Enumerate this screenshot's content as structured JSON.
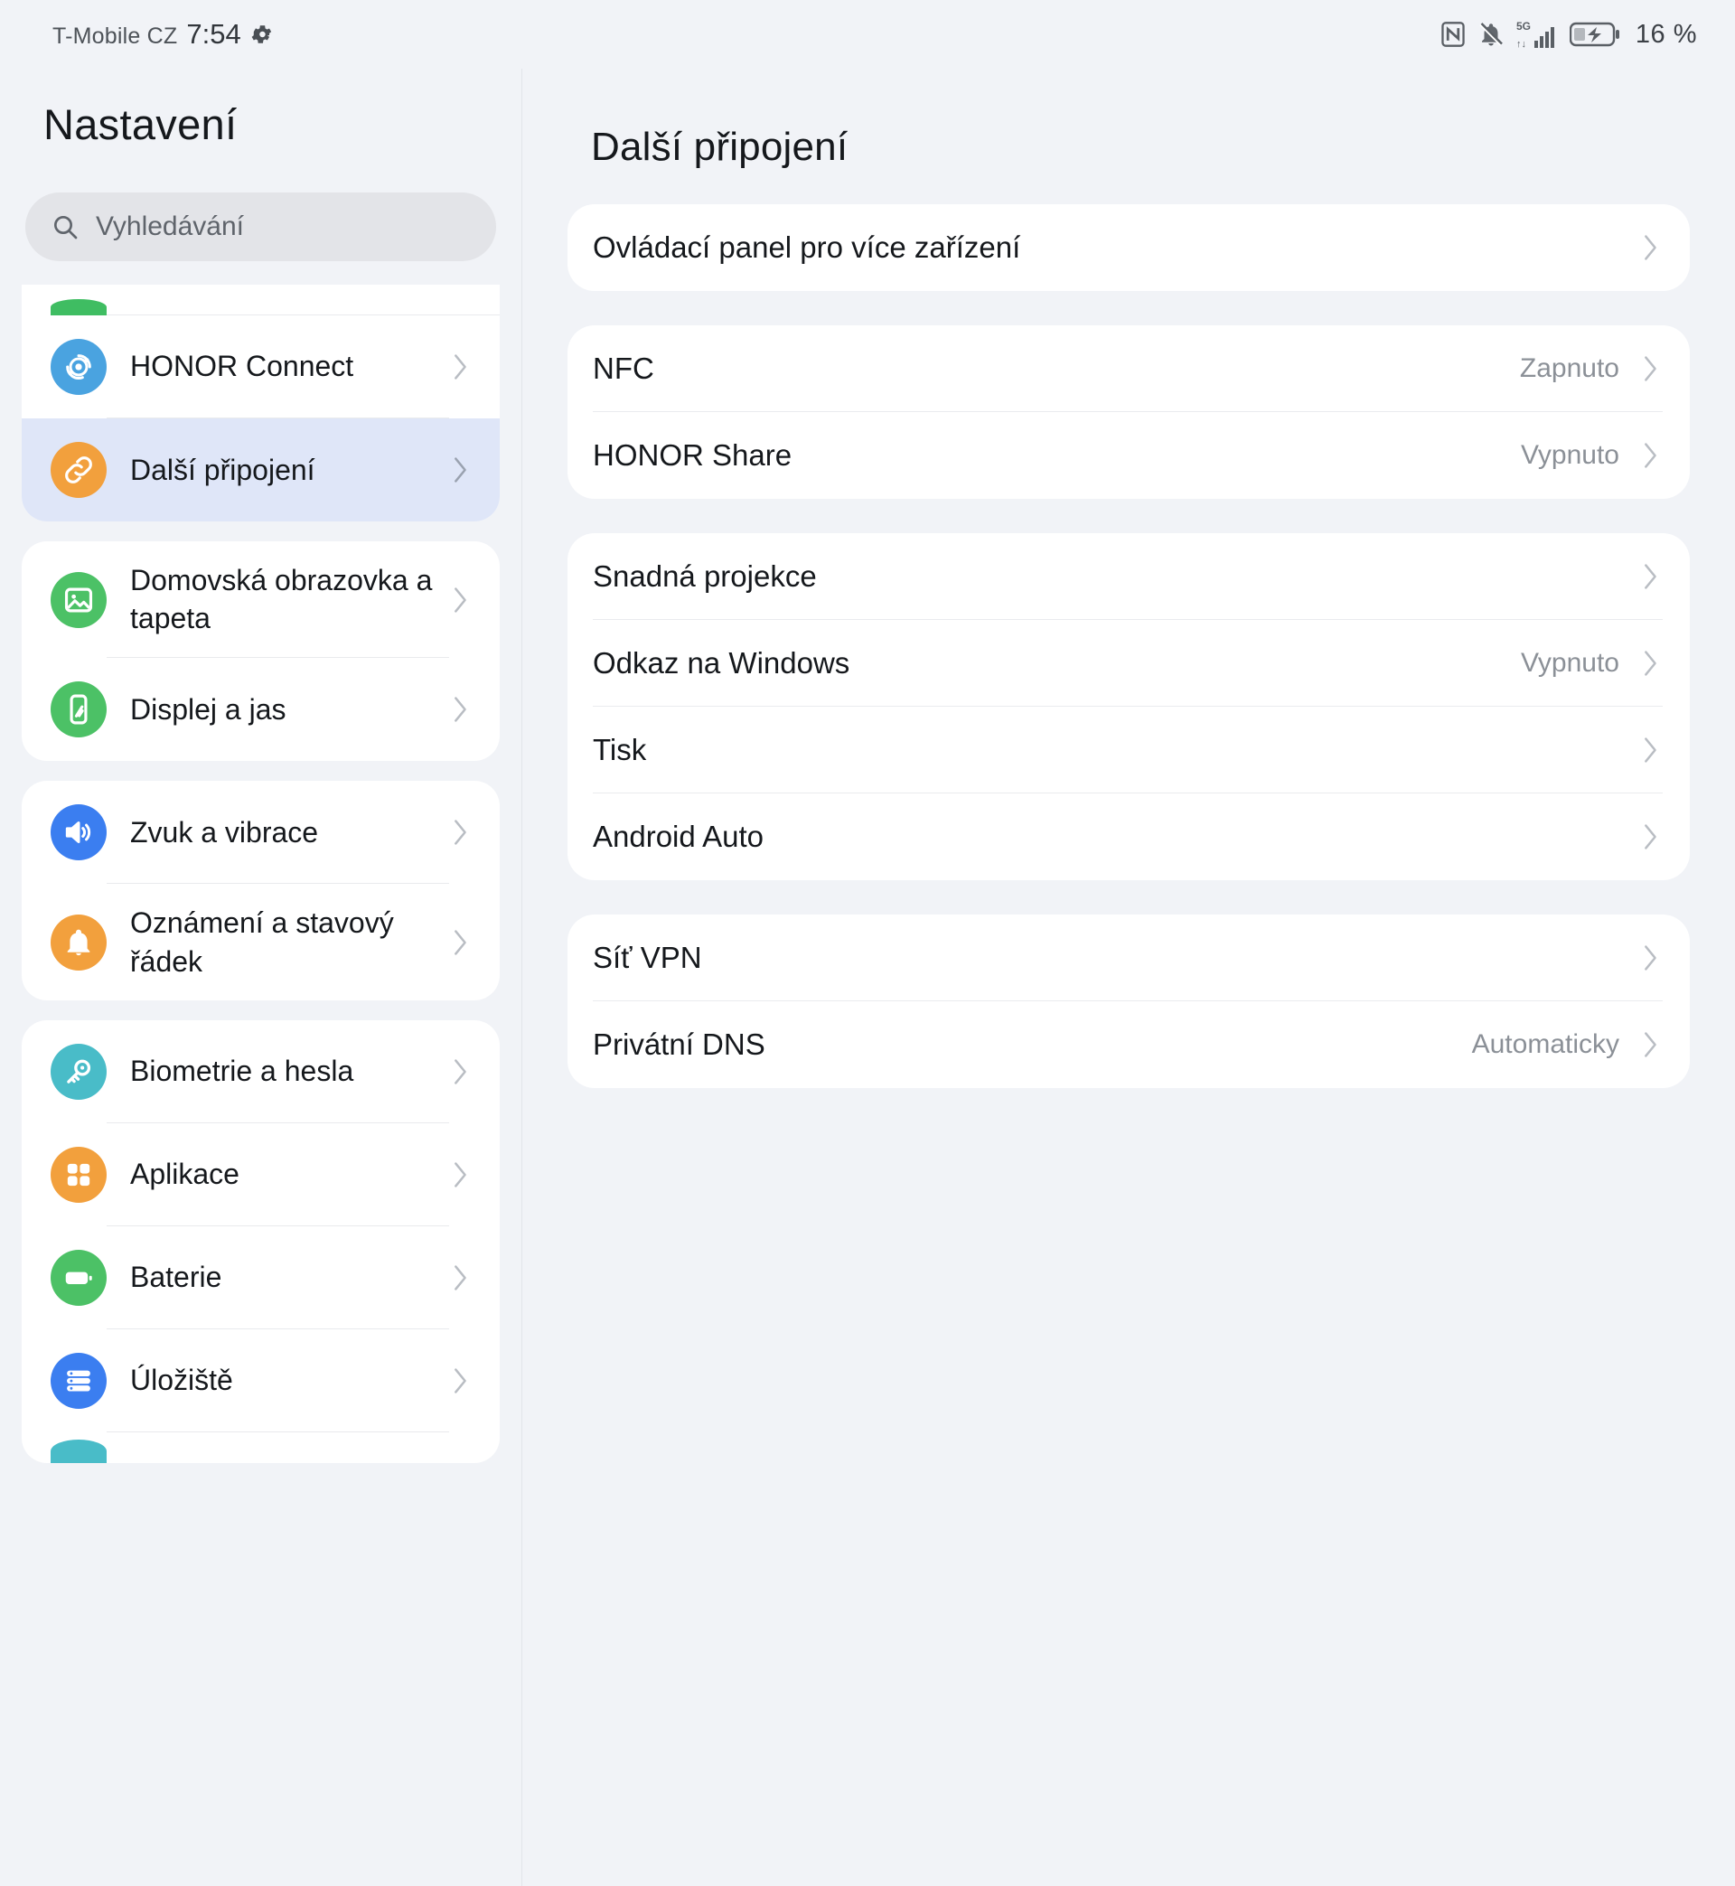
{
  "status_bar": {
    "carrier": "T-Mobile CZ",
    "time": "7:54",
    "gear_icon": "gear-icon",
    "icons": [
      "nfc-icon",
      "bell-muted-icon",
      "signal-5g-icon",
      "battery-charging-icon"
    ],
    "battery_text": "16 %"
  },
  "sidebar": {
    "title": "Nastaveni_PLACEHOLDER",
    "title_text": "Nastavení",
    "search": {
      "placeholder": "Vyhledávání",
      "value": "",
      "icon": "search-icon"
    },
    "groups": [
      {
        "clipped": true,
        "items": [
          {
            "label": "",
            "icon": "partial-green-icon",
            "color": "#3fbd62",
            "partial": true,
            "chevron": false
          },
          {
            "label": "HONOR Connect",
            "icon": "honor-connect-icon",
            "color": "#4aa3e0",
            "chevron": true,
            "selected": false
          },
          {
            "label": "Další připojení",
            "icon": "link-icon",
            "color": "#f2a03d",
            "chevron": true,
            "selected": true
          }
        ]
      },
      {
        "items": [
          {
            "label": "Domovská obrazovka a tapeta",
            "icon": "wallpaper-icon",
            "color": "#4cc166",
            "chevron": true
          },
          {
            "label": "Displej a jas",
            "icon": "display-brightness-icon",
            "color": "#4cc166",
            "chevron": true
          }
        ]
      },
      {
        "items": [
          {
            "label": "Zvuk a vibrace",
            "icon": "speaker-icon",
            "color": "#3b7ef0",
            "chevron": true
          },
          {
            "label": "Oznámení a stavový řádek",
            "icon": "bell-icon",
            "color": "#f2a03d",
            "chevron": true
          }
        ]
      },
      {
        "items": [
          {
            "label": "Biometrie a hesla",
            "icon": "key-icon",
            "color": "#49bcc8",
            "chevron": true
          },
          {
            "label": "Aplikace",
            "icon": "apps-grid-icon",
            "color": "#f2a03d",
            "chevron": true
          },
          {
            "label": "Baterie",
            "icon": "battery-icon",
            "color": "#4cc166",
            "chevron": true
          },
          {
            "label": "Úložiště",
            "icon": "storage-icon",
            "color": "#3b7ef0",
            "chevron": true
          },
          {
            "label": "",
            "icon": "partial-teal-icon",
            "color": "#49bcc8",
            "partial": true,
            "chevron": false
          }
        ]
      }
    ]
  },
  "main": {
    "title": "Další připojení",
    "groups": [
      {
        "rows": [
          {
            "label": "Ovládací panel pro více zařízení",
            "value": "",
            "chevron": true
          }
        ]
      },
      {
        "rows": [
          {
            "label": "NFC",
            "value": "Zapnuto",
            "chevron": true
          },
          {
            "label": "HONOR Share",
            "value": "Vypnuto",
            "chevron": true
          }
        ]
      },
      {
        "rows": [
          {
            "label": "Snadná projekce",
            "value": "",
            "chevron": true
          },
          {
            "label": "Odkaz na Windows",
            "value": "Vypnuto",
            "chevron": true
          },
          {
            "label": "Tisk",
            "value": "",
            "chevron": true
          },
          {
            "label": "Android Auto",
            "value": "",
            "chevron": true
          }
        ]
      },
      {
        "rows": [
          {
            "label": "Síť VPN",
            "value": "",
            "chevron": true
          },
          {
            "label": "Privátní DNS",
            "value": "Automaticky",
            "chevron": true
          }
        ]
      }
    ]
  },
  "colors": {
    "page_bg": "#f1f3f7",
    "card_bg": "#ffffff",
    "selected_bg": "#dfe6f8",
    "text_primary": "#15181c",
    "text_secondary": "#8b9097",
    "accent_blue": "#3b7ef0",
    "accent_orange": "#f2a03d",
    "accent_green": "#4cc166",
    "accent_teal": "#49bcc8"
  }
}
